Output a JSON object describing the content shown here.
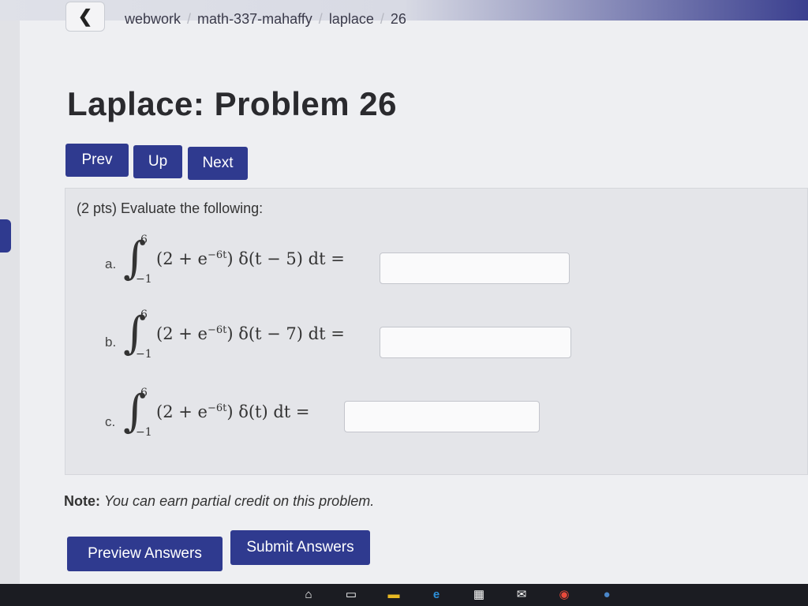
{
  "breadcrumb": {
    "items": [
      "webwork",
      "math-337-mahaffy",
      "laplace",
      "26"
    ],
    "separator": "/"
  },
  "page_title": "Laplace: Problem 26",
  "nav": {
    "prev_label": "Prev",
    "up_label": "Up",
    "next_label": "Next"
  },
  "problem": {
    "intro": "(2 pts) Evaluate the following:",
    "parts": [
      {
        "label": "a.",
        "upper": "6",
        "lower": "−1",
        "integrand_prefix": "(2 + e",
        "exponent": "−6t",
        "integrand_suffix": ") δ(t − 5) dt =",
        "answer": ""
      },
      {
        "label": "b.",
        "upper": "6",
        "lower": "−1",
        "integrand_prefix": "(2 + e",
        "exponent": "−6t",
        "integrand_suffix": ") δ(t − 7) dt =",
        "answer": ""
      },
      {
        "label": "c.",
        "upper": "6",
        "lower": "−1",
        "integrand_prefix": "(2 + e",
        "exponent": "−6t",
        "integrand_suffix": ") δ(t) dt =",
        "answer": ""
      }
    ]
  },
  "note": {
    "bold": "Note:",
    "text": "You can earn partial credit on this problem."
  },
  "actions": {
    "preview_label": "Preview Answers",
    "submit_label": "Submit Answers"
  },
  "colors": {
    "button_bg": "#2f3a8f",
    "page_bg": "#eeeff2"
  },
  "taskbar": {
    "icons": [
      "task-view-icon",
      "taskbar-window-icon",
      "file-explorer-icon",
      "edge-browser-icon",
      "store-icon",
      "mail-icon",
      "chrome-icon",
      "globe-icon"
    ]
  }
}
